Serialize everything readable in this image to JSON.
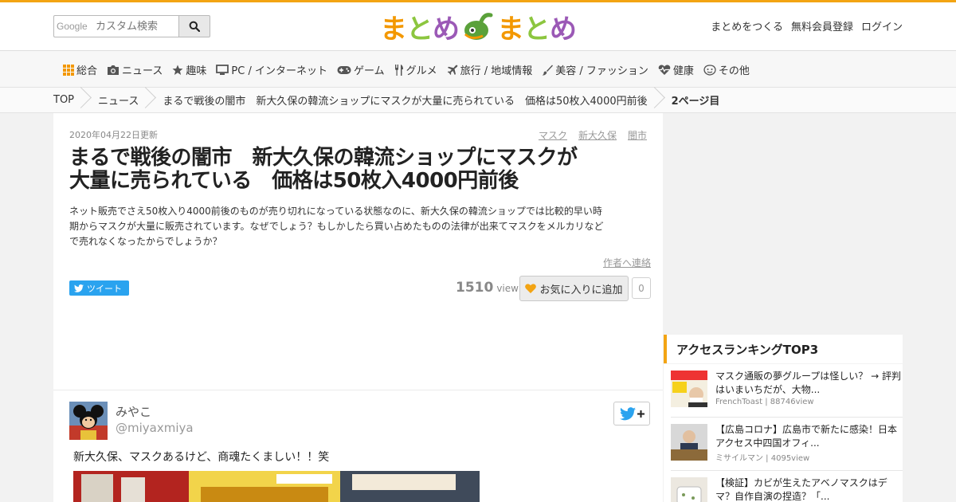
{
  "header": {
    "search_brand": "Google",
    "search_placeholder": "カスタム検索",
    "logo": [
      {
        "ch": "ま",
        "color": "#f39800"
      },
      {
        "ch": "と",
        "color": "#8cc63f"
      },
      {
        "ch": "め",
        "color": "#9b59b6"
      },
      {
        "ch": "ま",
        "color": "#f39800"
      },
      {
        "ch": "と",
        "color": "#8cc63f"
      },
      {
        "ch": "め",
        "color": "#9b59b6"
      }
    ],
    "links": [
      "まとめをつくる",
      "無料会員登録",
      "ログイン"
    ]
  },
  "nav": [
    {
      "icon": "grid-icon",
      "label": "総合"
    },
    {
      "icon": "camera-icon",
      "label": "ニュース"
    },
    {
      "icon": "star-icon",
      "label": "趣味"
    },
    {
      "icon": "monitor-icon",
      "label": "PC / インターネット"
    },
    {
      "icon": "gamepad-icon",
      "label": "ゲーム"
    },
    {
      "icon": "cutlery-icon",
      "label": "グルメ"
    },
    {
      "icon": "plane-icon",
      "label": "旅行 / 地域情報"
    },
    {
      "icon": "brush-icon",
      "label": "美容 / ファッション"
    },
    {
      "icon": "heartbeat-icon",
      "label": "健康"
    },
    {
      "icon": "smile-icon",
      "label": "その他"
    }
  ],
  "breadcrumb": {
    "items": [
      "TOP",
      "ニュース",
      "まるで戦後の闇市　新大久保の韓流ショップにマスクが大量に売られている　価格は50枚入4000円前後"
    ],
    "current": "2ページ目"
  },
  "article": {
    "date": "2020年04月22日更新",
    "tags": [
      "マスク",
      "新大久保",
      "闇市"
    ],
    "title_line1": "まるで戦後の闇市　新大久保の韓流ショップにマスクが",
    "title_line2": "大量に売られている　価格は50枚入4000円前後",
    "desc_line1": "ネット販売でさえ50枚入り4000前後のものが売り切れになっている状態なのに、新大久保の韓流ショップでは比較的早い時",
    "desc_line2": "期からマスクが大量に販売されています。なぜでしょう？もしかしたら買い占めたものの法律が出来てマスクをメルカリなど",
    "desc_line3": "で売れなくなったからでしょうか？",
    "contact": "作者へ連絡",
    "tweet_label": "ツイート",
    "views": "1510",
    "views_label": "view",
    "fav_label": "お気に入りに追加",
    "fav_count": "0"
  },
  "tweet": {
    "name": "みやこ",
    "handle": "@miyaxmiya",
    "text": "新大久保、マスクあるけど、商魂たくましい！！笑"
  },
  "ranking": {
    "title": "アクセスランキングTOP3",
    "items": [
      {
        "title_line1": "マスク通販の夢グループは怪しい？ → 評判",
        "title_line2": "はいまいちだが、大物...",
        "meta": "FrenchToast | 88746view"
      },
      {
        "title_line1": "【広島コロナ】広島市で新たに感染！日本",
        "title_line2": "アクセス中四国オフィ...",
        "meta": "ミサイルマン | 4095view"
      },
      {
        "title_line1": "【検証】カビが生えたアベノマスクはデ",
        "title_line2": "マ？自作自演の捏造？「...",
        "meta": ""
      }
    ]
  },
  "colors": {
    "accent": "#f3a413",
    "twitter": "#2aa3ef"
  }
}
